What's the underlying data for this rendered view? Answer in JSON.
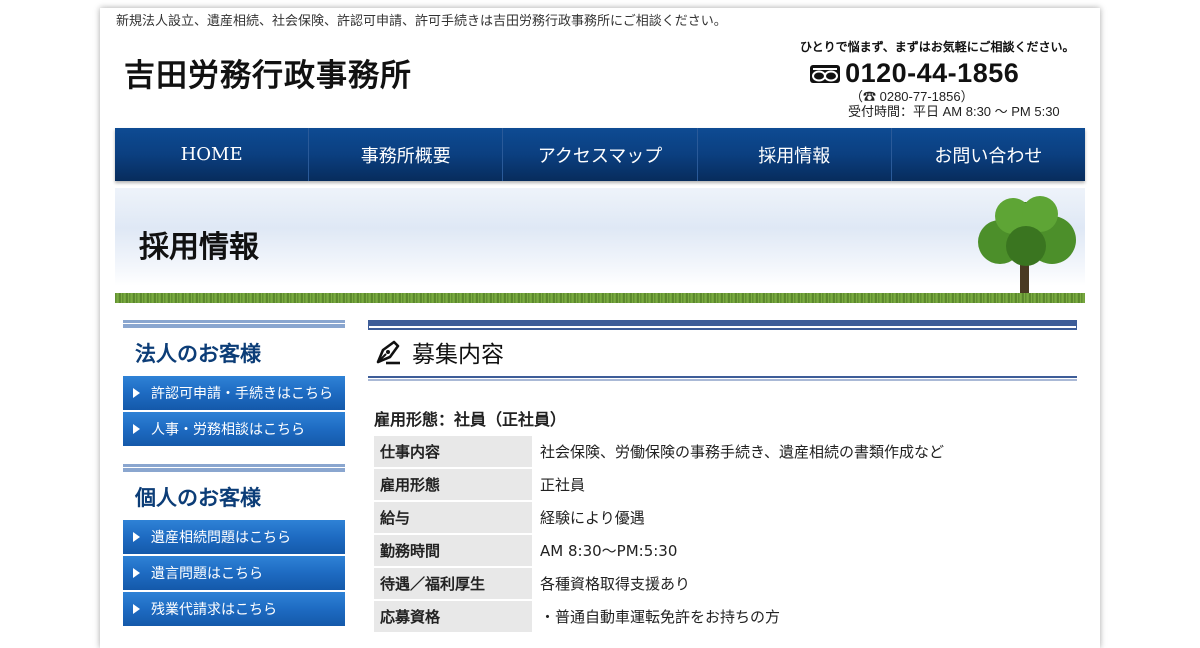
{
  "header": {
    "tagline": "新規法人設立、遺産相続、社会保険、許認可申請、許可手続きは吉田労務行政事務所にご相談ください。",
    "site_title": "吉田労務行政事務所",
    "contact_lead": "ひとりで悩まず、まずはお気軽にご相談ください。",
    "free_dial": "0120-44-1856",
    "tel": "（☎ 0280-77-1856）",
    "hours": "受付時間：平日 AM 8:30 〜 PM 5:30"
  },
  "nav": [
    {
      "label": "HOME"
    },
    {
      "label": "事務所概要"
    },
    {
      "label": "アクセスマップ"
    },
    {
      "label": "採用情報"
    },
    {
      "label": "お問い合わせ"
    }
  ],
  "banner": {
    "title": "採用情報"
  },
  "sidebar": {
    "corporate": {
      "heading": "法人のお客様",
      "items": [
        {
          "label": "許認可申請・手続きはこちら"
        },
        {
          "label": "人事・労務相談はこちら"
        }
      ]
    },
    "individual": {
      "heading": "個人のお客様",
      "items": [
        {
          "label": "遺産相続問題はこちら"
        },
        {
          "label": "遺言問題はこちら"
        },
        {
          "label": "残業代請求はこちら"
        }
      ]
    }
  },
  "main": {
    "section_title": "募集内容",
    "job_type": "雇用形態：社員（正社員）",
    "rows": [
      {
        "key": "仕事内容",
        "value": "社会保険、労働保険の事務手続き、遺産相続の書類作成など"
      },
      {
        "key": "雇用形態",
        "value": "正社員"
      },
      {
        "key": "給与",
        "value": "経験により優遇"
      },
      {
        "key": "勤務時間",
        "value": "AM 8:30〜PM:5:30"
      },
      {
        "key": "待遇／福利厚生",
        "value": "各種資格取得支援あり"
      },
      {
        "key": "応募資格",
        "value": "・普通自動車運転免許をお持ちの方"
      }
    ]
  },
  "colors": {
    "nav_bg": "#0b3f80",
    "side_button": "#1e6bc2",
    "heading_blue": "#0c3d77",
    "rule": "#3e5d98"
  },
  "icons": [
    "free-dial-icon",
    "pen-icon",
    "arrow-right-icon",
    "tree-icon"
  ]
}
